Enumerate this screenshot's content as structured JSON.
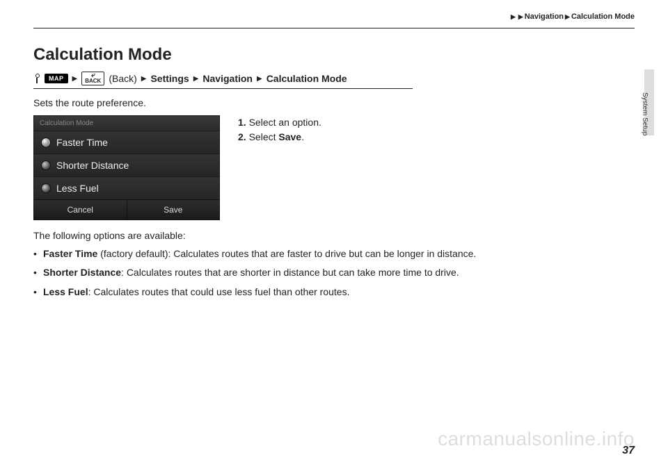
{
  "breadcrumb": {
    "seg1": "Navigation",
    "seg2": "Calculation Mode"
  },
  "side_tab_label": "System Setup",
  "title": "Calculation Mode",
  "nav_path": {
    "map_badge": "MAP",
    "back_arrow": "⤶",
    "back_text": "BACK",
    "back_label": "(Back)",
    "seg_settings": "Settings",
    "seg_navigation": "Navigation",
    "seg_calcmode": "Calculation Mode"
  },
  "intro": "Sets the route preference.",
  "screenshot": {
    "header": "Calculation Mode",
    "opt1": "Faster Time",
    "opt2": "Shorter Distance",
    "opt3": "Less Fuel",
    "cancel": "Cancel",
    "save": "Save"
  },
  "steps": {
    "s1_num": "1.",
    "s1_text": "Select an option.",
    "s2_num": "2.",
    "s2_text_a": "Select ",
    "s2_bold": "Save",
    "s2_text_b": "."
  },
  "desc_intro": "The following options are available:",
  "bullets": {
    "b1_bold": "Faster Time",
    "b1_rest": " (factory default): Calculates routes that are faster to drive but can be longer in distance.",
    "b2_bold": "Shorter Distance",
    "b2_rest": ": Calculates routes that are shorter in distance but can take more time to drive.",
    "b3_bold": "Less Fuel",
    "b3_rest": ": Calculates routes that could use less fuel than other routes."
  },
  "watermark": "carmanualsonline.info",
  "page_number": "37"
}
